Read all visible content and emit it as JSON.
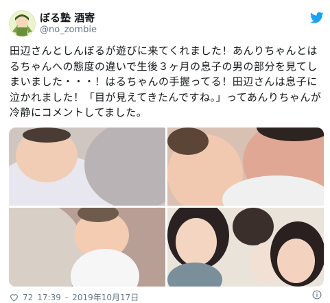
{
  "user": {
    "name": "ぼる塾 酒寄",
    "handle": "@no_zombie"
  },
  "tweet": {
    "text": "田辺さんとしんぼるが遊びに来てくれました！あんりちゃんとはるちゃんへの態度の違いで生後３ヶ月の息子の男の部分を見てしまいました・・・！はるちゃんの手握ってる！田辺さんは息子に泣かれました！「目が見えてきたんですね。」ってあんりちゃんが冷静にコメントしてました。"
  },
  "footer": {
    "likes": "72",
    "time": "17:39",
    "date": "2019年10月17日"
  },
  "colors": {
    "twitter_blue": "#1da1f2",
    "secondary_text": "#657786"
  },
  "icons": {
    "brand": "twitter-bird-icon",
    "like": "heart-icon",
    "info": "info-icon"
  }
}
